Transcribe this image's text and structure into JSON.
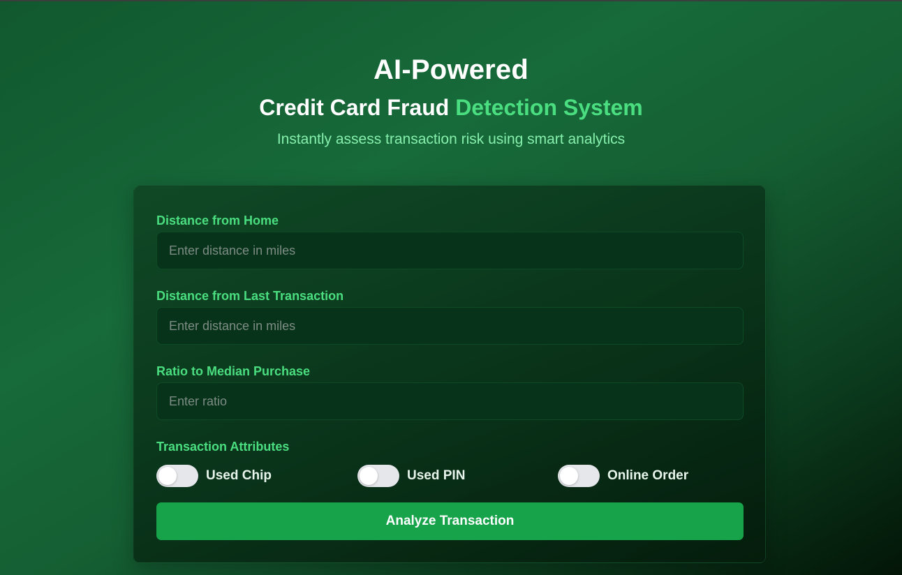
{
  "hero": {
    "title": "AI-Powered",
    "subtitle_main": "Credit Card Fraud",
    "subtitle_accent": "Detection System",
    "tagline": "Instantly assess transaction risk using smart analytics"
  },
  "form": {
    "fields": [
      {
        "label": "Distance from Home",
        "placeholder": "Enter distance in miles",
        "value": ""
      },
      {
        "label": "Distance from Last Transaction",
        "placeholder": "Enter distance in miles",
        "value": ""
      },
      {
        "label": "Ratio to Median Purchase",
        "placeholder": "Enter ratio",
        "value": ""
      }
    ],
    "attributes_label": "Transaction Attributes",
    "toggles": [
      {
        "label": "Used Chip",
        "on": false
      },
      {
        "label": "Used PIN",
        "on": false
      },
      {
        "label": "Online Order",
        "on": false
      }
    ],
    "submit_label": "Analyze Transaction"
  },
  "colors": {
    "accent": "#4ade80",
    "tagline": "#86efac",
    "button": "#16a34a",
    "toggle_off": "#e5e7eb"
  }
}
